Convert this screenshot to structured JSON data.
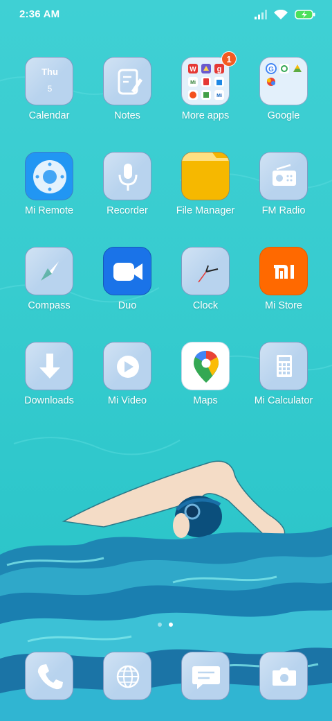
{
  "status_bar": {
    "time": "2:36 AM",
    "icons": [
      "signal-icon",
      "wifi-icon",
      "battery-charging-icon"
    ]
  },
  "calendar_icon": {
    "day": "Thu",
    "date": "5"
  },
  "folder_badge": "1",
  "apps": [
    {
      "label": "Calendar",
      "icon": "calendar-icon"
    },
    {
      "label": "Notes",
      "icon": "notes-icon"
    },
    {
      "label": "More apps",
      "icon": "folder-icon"
    },
    {
      "label": "Google",
      "icon": "folder-icon"
    },
    {
      "label": "Mi Remote",
      "icon": "remote-icon"
    },
    {
      "label": "Recorder",
      "icon": "microphone-icon"
    },
    {
      "label": "File Manager",
      "icon": "file-manager-icon"
    },
    {
      "label": "FM Radio",
      "icon": "radio-icon"
    },
    {
      "label": "Compass",
      "icon": "compass-icon"
    },
    {
      "label": "Duo",
      "icon": "video-camera-icon"
    },
    {
      "label": "Clock",
      "icon": "clock-icon"
    },
    {
      "label": "Mi Store",
      "icon": "mi-logo-icon"
    },
    {
      "label": "Downloads",
      "icon": "download-icon"
    },
    {
      "label": "Mi Video",
      "icon": "play-icon"
    },
    {
      "label": "Maps",
      "icon": "maps-pin-icon"
    },
    {
      "label": "Mi Calculator",
      "icon": "calculator-icon"
    }
  ],
  "dock": [
    {
      "icon": "phone-icon"
    },
    {
      "icon": "browser-globe-icon"
    },
    {
      "icon": "messages-icon"
    },
    {
      "icon": "camera-icon"
    }
  ],
  "page_indicator": {
    "pages": 2,
    "current": 2
  },
  "colors": {
    "wallpaper": "#37cccf",
    "tile": "#b8d3ee",
    "badge": "#f35b21",
    "mi_orange": "#ff6900",
    "duo_blue": "#1a73e8",
    "file_yellow": "#f4b400"
  }
}
